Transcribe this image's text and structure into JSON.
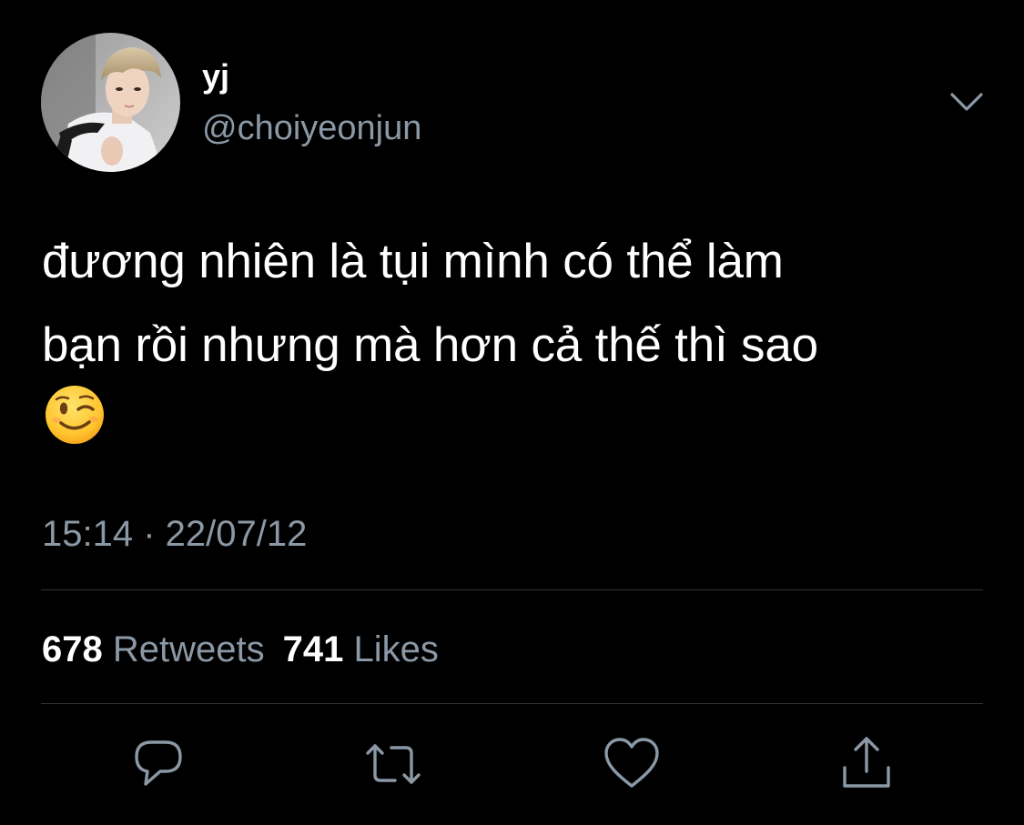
{
  "user": {
    "display_name": "yj",
    "handle": "@choiyeonjun",
    "avatar": "profile-photo"
  },
  "tweet": {
    "text_lines": [
      "đương nhiên là tụi mình có thể làm",
      "bạn rồi nhưng mà hơn cả thế thì sao"
    ],
    "emoji": "😉",
    "timestamp": "15:14 · 22/07/12"
  },
  "stats": {
    "retweets_count": "678",
    "retweets_label": "Retweets",
    "likes_count": "741",
    "likes_label": "Likes"
  },
  "actions": {
    "reply": "reply-icon",
    "retweet": "retweet-icon",
    "like": "heart-icon",
    "share": "share-icon",
    "more": "chevron-down-icon"
  },
  "colors": {
    "background": "#000000",
    "text_primary": "#ffffff",
    "text_secondary": "#8b98a5",
    "divider": "#2f3336"
  }
}
